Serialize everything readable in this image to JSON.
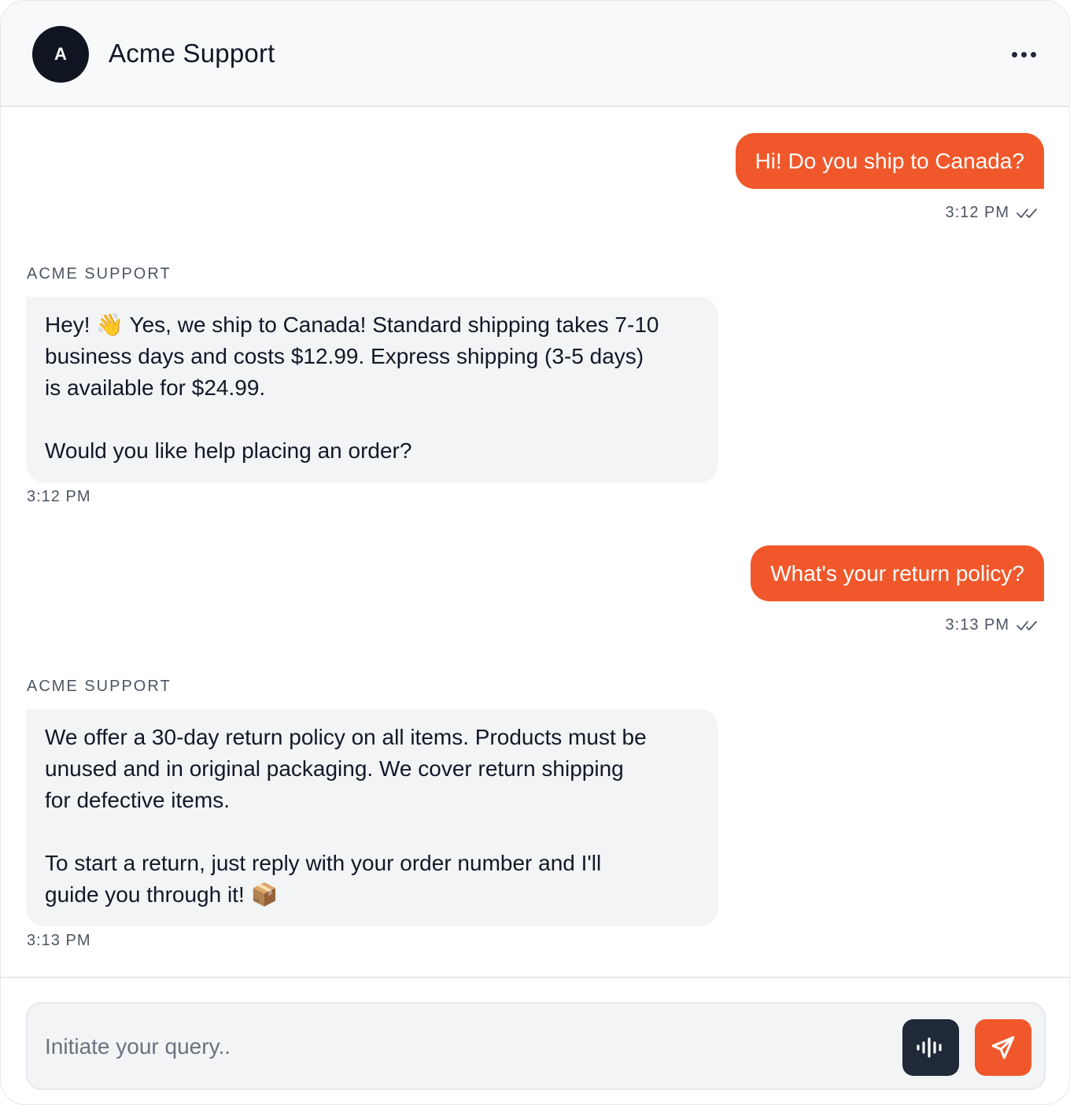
{
  "header": {
    "avatar_initial": "A",
    "title": "Acme Support",
    "more_icon": "more-horizontal-icon"
  },
  "messages": [
    {
      "from": "user",
      "text": "Hi! Do you ship to Canada?",
      "time": "3:12 PM",
      "status": "read"
    },
    {
      "from": "agent",
      "sender": "ACME SUPPORT",
      "paragraphs": [
        "Hey! 👋 Yes, we ship to Canada! Standard shipping takes 7-10\nbusiness days and costs $12.99. Express shipping (3-5 days)\nis available for $24.99.",
        "Would you like help placing an order?"
      ],
      "time": "3:12 PM"
    },
    {
      "from": "user",
      "text": "What's your return policy?",
      "time": "3:13 PM",
      "status": "read"
    },
    {
      "from": "agent",
      "sender": "ACME SUPPORT",
      "paragraphs": [
        "We offer a 30-day return policy on all items. Products must be\nunused and in original packaging. We cover return shipping\nfor defective items.",
        "To start a return, just reply with your order number and I'll\nguide you through it! 📦"
      ],
      "time": "3:13 PM"
    }
  ],
  "composer": {
    "placeholder": "Initiate your query..",
    "value": "",
    "voice_icon": "audio-waveform-icon",
    "send_icon": "send-icon"
  },
  "colors": {
    "accent": "#f0582b",
    "dark": "#1f2937",
    "incoming_bubble": "#f3f4f6",
    "header_bg": "#f8f9fb"
  }
}
